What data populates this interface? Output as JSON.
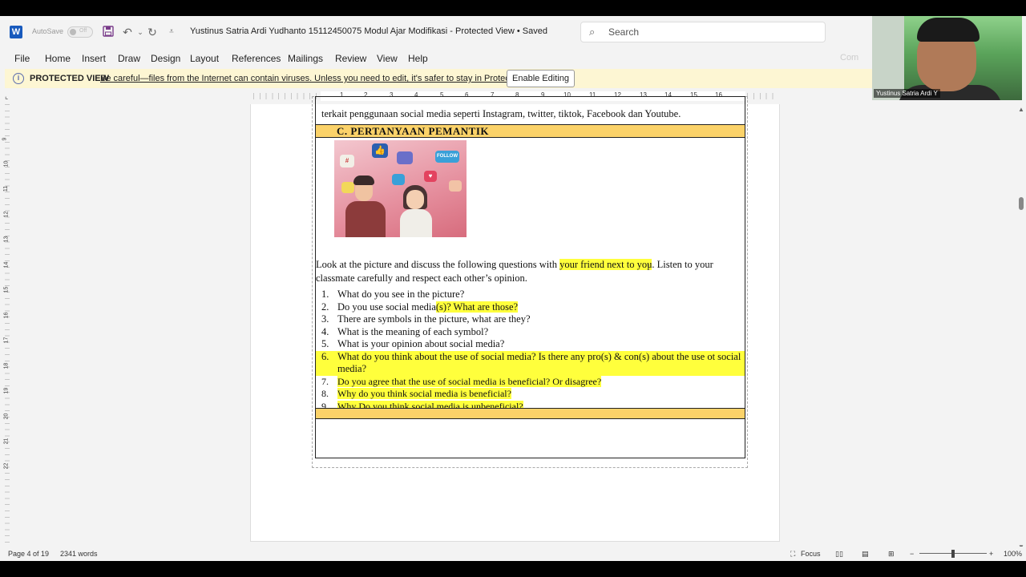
{
  "titlebar": {
    "logo": "W",
    "autosave": "AutoSave",
    "autosave_state": "Off",
    "doc_title": "Yustinus Satria Ardi Yudhanto 15112450075 Modul Ajar Modifikasi  -  Protected View • Saved",
    "search_placeholder": "Search"
  },
  "webcam": {
    "name": "Yustinus Satria Ardi Y"
  },
  "menu": [
    "File",
    "Home",
    "Insert",
    "Draw",
    "Design",
    "Layout",
    "References",
    "Mailings",
    "Review",
    "View",
    "Help"
  ],
  "comments_ghost": "Com",
  "protected": {
    "title": "PROTECTED VIEW",
    "message": "Be careful—files from the Internet can contain viruses. Unless you need to edit, it's safer to stay in Protected View.",
    "button": "Enable Editing"
  },
  "ruler": {
    "h": [
      "1",
      "2",
      "3",
      "4",
      "5",
      "6",
      "7",
      "8",
      "9",
      "10",
      "11",
      "12",
      "13",
      "14",
      "15",
      "16"
    ],
    "v": [
      "9",
      "10",
      "11",
      "12",
      "13",
      "14",
      "15",
      "16",
      "17",
      "18",
      "19",
      "20",
      "21",
      "22"
    ]
  },
  "document": {
    "prev_line": "terkait penggunaan social media seperti Instagram,  twitter, tiktok, Facebook dan Youtube.",
    "section_heading": "C. PERTANYAAN PEMANTIK",
    "picture_labels": {
      "follow": "FOLLOW",
      "hash": "#"
    },
    "instruction": {
      "before": "Look at the picture and discuss the following questions with ",
      "highlight": "your friend next to you",
      "after": ". Listen to your classmate carefully and respect each other’s opinion."
    },
    "questions": [
      {
        "n": "1.",
        "text": "What do you see in the picture?"
      },
      {
        "n": "2.",
        "text_before": "Do you use social media",
        "text_hl": "(s)? What are those?"
      },
      {
        "n": "3.",
        "text": "There are symbols in the picture, what are they?"
      },
      {
        "n": "4.",
        "text": "What is the meaning of each symbol?"
      },
      {
        "n": "5.",
        "text": "What is your opinion about social media?"
      },
      {
        "n": "6.",
        "text": "What do you think about the use of social media? Is there any pro(s) & con(s) about the use ot social media?"
      },
      {
        "n": "7.",
        "text": "Do you agree that the use of social media is beneficial? Or disagree?"
      },
      {
        "n": "8.",
        "text": "Why do you think social media is beneficial?"
      },
      {
        "n": "9.",
        "text": "Why Do you think social media is unbeneficial?"
      }
    ]
  },
  "statusbar": {
    "page": "Page 4 of 19",
    "words": "2341 words",
    "focus": "Focus",
    "zoom": "100%"
  },
  "colors": {
    "accent": "#185abd",
    "heading_band": "#fbd269",
    "highlight": "#ffff3c",
    "protected_bg": "#fdf6d3"
  }
}
